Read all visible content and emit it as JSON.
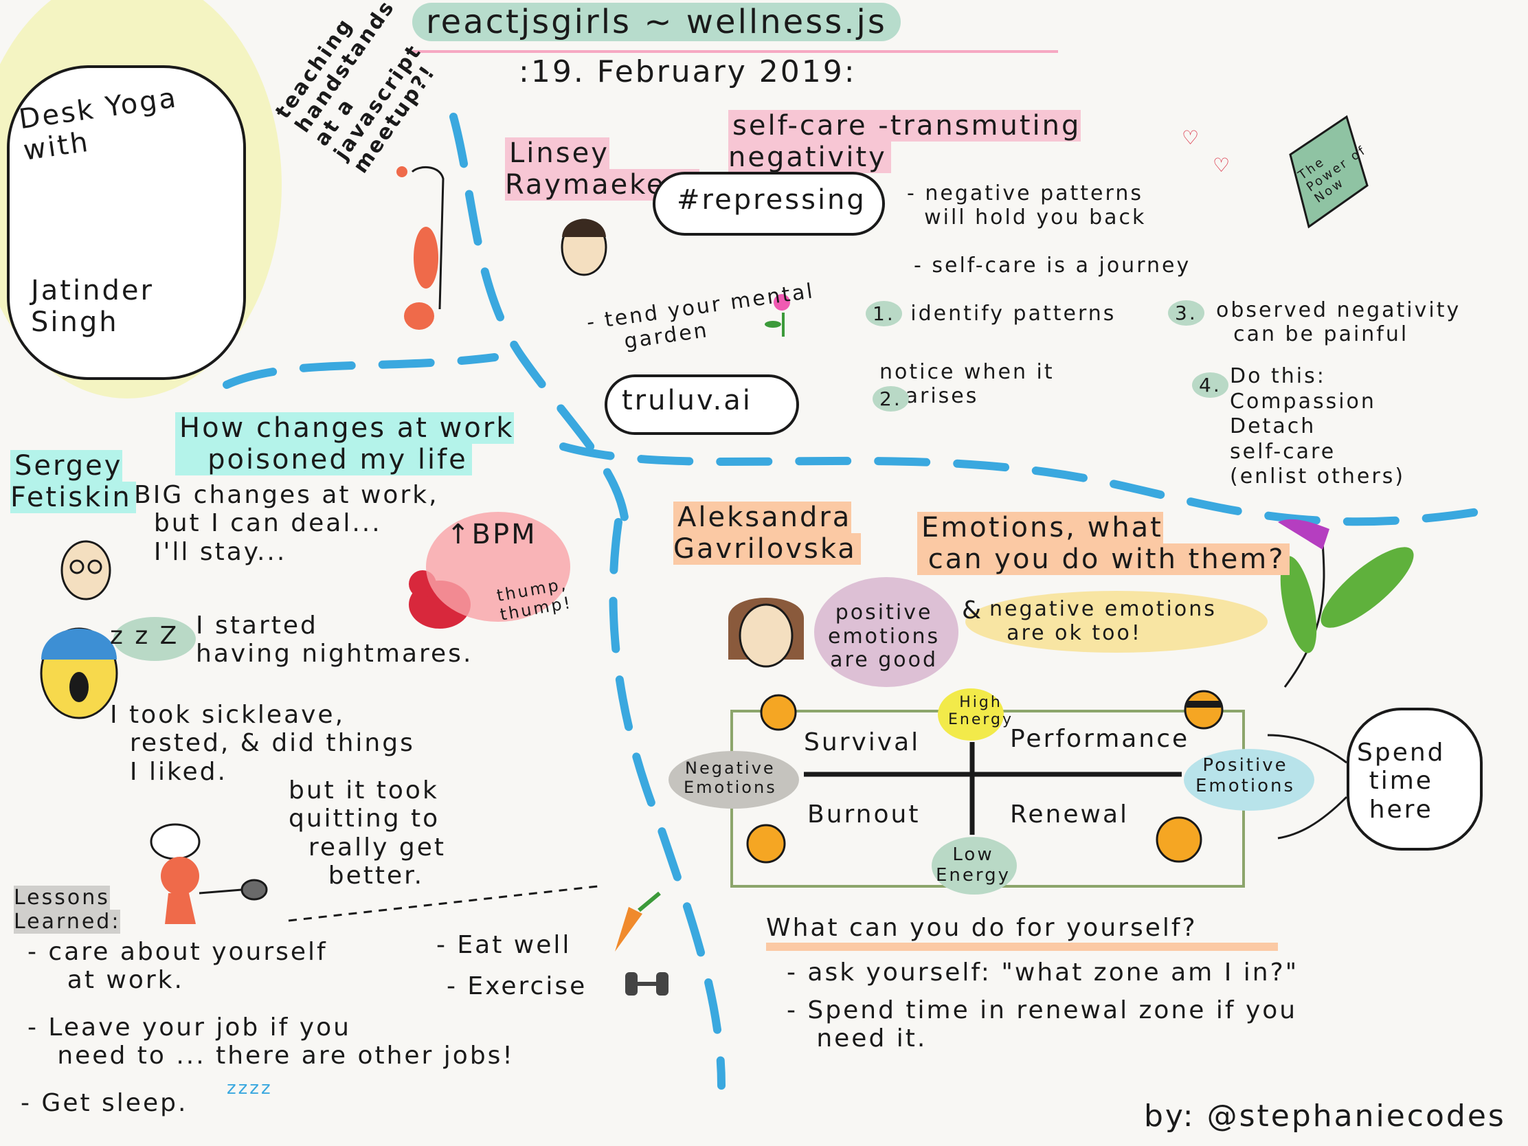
{
  "header": {
    "title": "reactjsgirls ~ wellness.js",
    "date": ":19. February 2019:"
  },
  "desk_yoga": {
    "title": "Desk Yoga\nwith",
    "name": "Jatinder\nSingh",
    "note": "teaching\nhandstands\nat a\njavascript\nmeetup?!"
  },
  "linsey": {
    "speaker": "Linsey\nRaymaekers",
    "topic": "self-care -transmuting\nnegativity",
    "cloud_tag": "#repressing",
    "cloud_link": "truluv.ai",
    "point_patterns": "- negative patterns\n  will hold you back",
    "point_journey": "- self-care is a journey",
    "point_garden": "- tend your mental\n    garden",
    "step1_num": "1.",
    "step1": "identify patterns",
    "step2_num": "2.",
    "step2": "notice when it\n   arises",
    "step3_num": "3.",
    "step3": "observed negativity\n  can be painful",
    "step4_num": "4.",
    "step4": "Do this:\nCompassion\nDetach\nself-care\n(enlist others)",
    "book": "The\nPower of\nNow"
  },
  "sergey": {
    "speaker": "Sergey\nFetiskin",
    "topic": "How changes at work\n   poisoned my life",
    "story1": "BIG changes at work,\n  but I can deal...\n  I'll stay...",
    "zzz": "z z Z",
    "story2": "I started\nhaving nightmares.",
    "story3": "I took sickleave,\n  rested, & did things\n  I liked.",
    "story4": "but it took\nquitting to\n  really get\n    better.",
    "bpm": "↑BPM",
    "thump": "thump,\nthump!",
    "lessons_title": "Lessons\nLearned:",
    "lessons": [
      "- care about yourself\n    at work.",
      "- Leave your job if you\n   need to ... there are other jobs!",
      "- Get sleep."
    ],
    "sleep_z": "zzzz",
    "eat": "- Eat well",
    "exercise": "- Exercise"
  },
  "aleksandra": {
    "speaker": "Aleksandra\nGavrilovska",
    "topic": "Emotions, what\n can you do with them?",
    "positive": "positive\nemotions\nare good",
    "amp": "&",
    "negative": "negative emotions\n  are ok too!",
    "quadrants": {
      "survival": "Survival",
      "performance": "Performance",
      "burnout": "Burnout",
      "renewal": "Renewal",
      "high": "High\nEnergy",
      "low": "Low\nEnergy",
      "neg": "Negative\nEmotions",
      "pos": "Positive\nEmotions"
    },
    "spend": "Spend\ntime\nhere",
    "question": "What can you do for yourself?",
    "answers": [
      "- ask yourself: \"what zone am I in?\"",
      "- Spend time in renewal zone if you\n   need it."
    ]
  },
  "footer": {
    "credit": "by: @stephaniecodes"
  },
  "colors": {
    "blue_divider": "#3aa8df",
    "yellow_glow": "#f2f3b5",
    "face_orange": "#f5a623",
    "heart_red": "#d8283c",
    "carrot": "#f08a2c",
    "leaf": "#3c9a3a",
    "flower": "#b53ec0"
  }
}
